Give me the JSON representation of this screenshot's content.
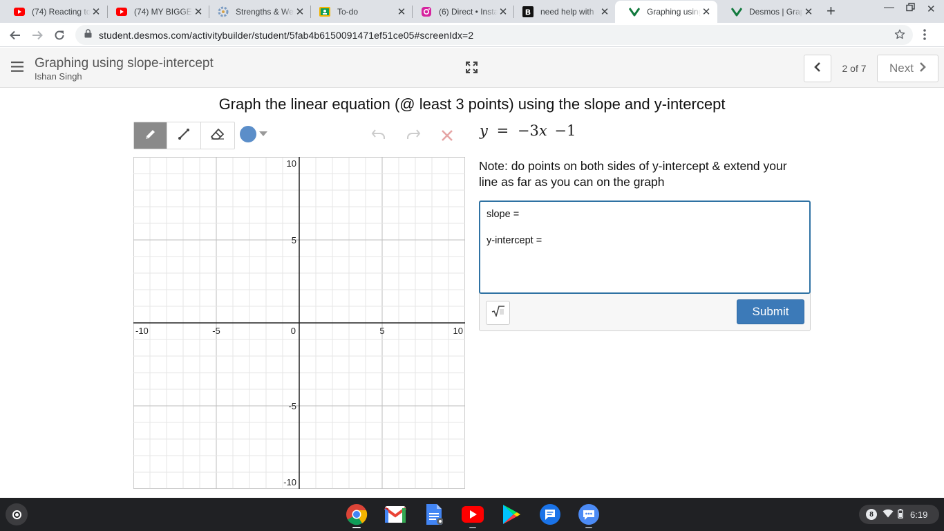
{
  "browser": {
    "tabs": [
      {
        "title": "(74) Reacting to",
        "icon": "youtube-icon"
      },
      {
        "title": "(74) MY BIGGEST",
        "icon": "youtube-icon"
      },
      {
        "title": "Strengths & We",
        "icon": "settings-app-icon"
      },
      {
        "title": "To-do",
        "icon": "classroom-icon"
      },
      {
        "title": "(6) Direct • Insta",
        "icon": "instagram-icon"
      },
      {
        "title": "need help with",
        "icon": "brainly-icon"
      },
      {
        "title": "Graphing using",
        "icon": "desmos-icon",
        "active": true
      },
      {
        "title": "Desmos | Graph",
        "icon": "desmos-icon"
      }
    ],
    "url": "student.desmos.com/activitybuilder/student/5fab4b6150091471ef51ce05#screenIdx=2"
  },
  "header": {
    "title": "Graphing using slope-intercept",
    "student": "Ishan Singh",
    "page_count": "2 of 7",
    "next_label": "Next"
  },
  "prompt": "Graph the linear equation (@ least 3 points) using the slope and y-intercept",
  "sketch": {
    "tools": [
      "pencil-tool",
      "line-tool",
      "eraser-tool"
    ],
    "selected_tool": "pencil-tool",
    "color": "#5b8ec9"
  },
  "graph": {
    "xlim": [
      -10,
      10
    ],
    "ylim": [
      -10,
      10
    ],
    "grid": true,
    "x_tick_labels": [
      "-10",
      "-5",
      "0",
      "5",
      "10"
    ],
    "y_tick_labels": [
      "10",
      "5",
      "-5",
      "-10"
    ]
  },
  "equation": {
    "lhs": "y",
    "eq": "=",
    "coef": "−3",
    "var": "x",
    "const": "−1"
  },
  "note": "Note: do points on both sides of y-intercept & extend your line as far as you can on the graph",
  "answer": {
    "text": "slope =\n\ny-intercept =",
    "submit_label": "Submit"
  },
  "shelf": {
    "apps": [
      "chrome-icon",
      "gmail-icon",
      "docs-icon",
      "youtube-icon",
      "play-store-icon",
      "messages-icon",
      "chat-icon"
    ],
    "notification_count": "8",
    "time": "6:19"
  }
}
